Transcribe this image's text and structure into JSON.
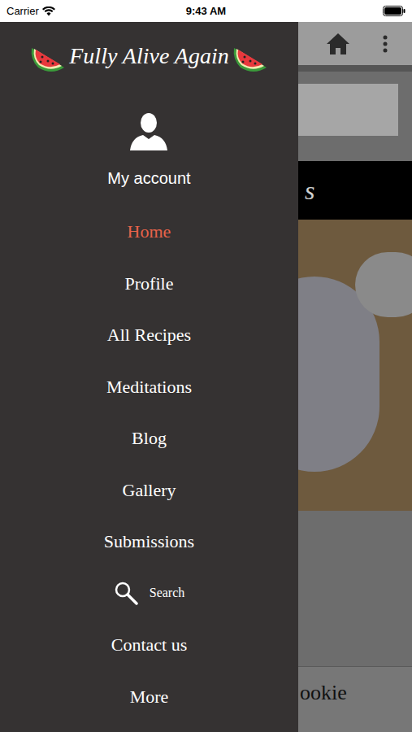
{
  "status_bar": {
    "carrier": "Carrier",
    "time": "9:43 AM"
  },
  "drawer": {
    "title": "Fully Alive Again",
    "account_label": "My account",
    "items": [
      {
        "label": "Home",
        "selected": true,
        "kind": "link"
      },
      {
        "label": "Profile",
        "selected": false,
        "kind": "link"
      },
      {
        "label": "All Recipes",
        "selected": false,
        "kind": "link"
      },
      {
        "label": "Meditations",
        "selected": false,
        "kind": "link"
      },
      {
        "label": "Blog",
        "selected": false,
        "kind": "link"
      },
      {
        "label": "Gallery",
        "selected": false,
        "kind": "link"
      },
      {
        "label": "Submissions",
        "selected": false,
        "kind": "link"
      },
      {
        "label": "Search",
        "selected": false,
        "kind": "search"
      },
      {
        "label": "Contact us",
        "selected": false,
        "kind": "link"
      },
      {
        "label": "More",
        "selected": false,
        "kind": "link"
      }
    ]
  },
  "background": {
    "banner_text": "s",
    "card_title": "ookie"
  }
}
